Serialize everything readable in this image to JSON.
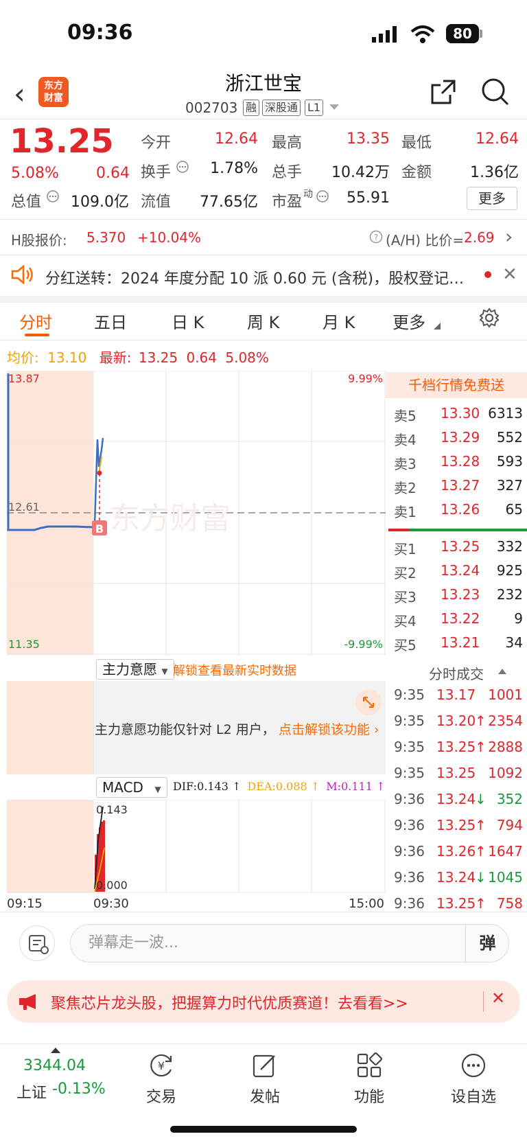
{
  "status": {
    "time": "09:36",
    "battery": "80"
  },
  "header": {
    "logo_line1": "东方",
    "logo_line2": "财富",
    "title": "浙江世宝",
    "code": "002703",
    "tags": [
      "融",
      "深股通",
      "L1"
    ]
  },
  "quote": {
    "price": "13.25",
    "pct": "5.08%",
    "change": "0.64",
    "stats": [
      {
        "label": "今开",
        "value": "12.64",
        "color": "red"
      },
      {
        "label": "最高",
        "value": "13.35",
        "color": "red"
      },
      {
        "label": "最低",
        "value": "12.64",
        "color": "red"
      },
      {
        "label": "换手",
        "value": "1.78%",
        "color": "dark"
      },
      {
        "label": "总手",
        "value": "10.42万",
        "color": "dark"
      },
      {
        "label": "金额",
        "value": "1.36亿",
        "color": "dark"
      },
      {
        "label": "总值",
        "value": "109.0亿",
        "color": "dark"
      },
      {
        "label": "流值",
        "value": "77.65亿",
        "color": "dark"
      },
      {
        "label": "市盈",
        "value": "55.91",
        "color": "dark"
      }
    ],
    "pe_super": "动",
    "more": "更多"
  },
  "hshare": {
    "label": "H股报价:",
    "price": "5.370",
    "pct": "+10.04%",
    "ah_label": "(A/H) 比价=",
    "ah_value": "2.69"
  },
  "dividend": {
    "text": "分红送转：2024 年度分配 10 派 0.60 元 (含税)，股权登记日..."
  },
  "tabs": [
    "分时",
    "五日",
    "日 K",
    "周 K",
    "月 K",
    "更多"
  ],
  "avg": {
    "label": "均价:",
    "value": "13.10",
    "latest_label": "最新:",
    "latest": "13.25",
    "chg": "0.64",
    "pct": "5.08%"
  },
  "chart": {
    "ymax": "13.87",
    "ymid": "12.61",
    "ymin": "11.35",
    "pmax": "9.99%",
    "pmin": "-9.99%",
    "marker": "B",
    "watermark": "东方财富"
  },
  "orderbook": {
    "promo": "千档行情免费送",
    "asks": [
      {
        "label": "卖5",
        "price": "13.30",
        "vol": "6313"
      },
      {
        "label": "卖4",
        "price": "13.29",
        "vol": "552"
      },
      {
        "label": "卖3",
        "price": "13.28",
        "vol": "593"
      },
      {
        "label": "卖2",
        "price": "13.27",
        "vol": "327"
      },
      {
        "label": "卖1",
        "price": "13.26",
        "vol": "65"
      }
    ],
    "bids": [
      {
        "label": "买1",
        "price": "13.25",
        "vol": "332"
      },
      {
        "label": "买2",
        "price": "13.24",
        "vol": "925"
      },
      {
        "label": "买3",
        "price": "13.23",
        "vol": "232"
      },
      {
        "label": "买4",
        "price": "13.22",
        "vol": "9"
      },
      {
        "label": "买5",
        "price": "13.21",
        "vol": "34"
      }
    ]
  },
  "trades": {
    "title": "分时成交",
    "rows": [
      {
        "time": "9:35",
        "price": "13.17",
        "arrow": "",
        "vol": "1001",
        "color": "red"
      },
      {
        "time": "9:35",
        "price": "13.20",
        "arrow": "↑",
        "vol": "2354",
        "color": "red"
      },
      {
        "time": "9:35",
        "price": "13.25",
        "arrow": "↑",
        "vol": "2888",
        "color": "red"
      },
      {
        "time": "9:35",
        "price": "13.25",
        "arrow": "",
        "vol": "1092",
        "color": "red"
      },
      {
        "time": "9:36",
        "price": "13.24",
        "arrow": "↓",
        "vol": "352",
        "color": "green"
      },
      {
        "time": "9:36",
        "price": "13.25",
        "arrow": "↑",
        "vol": "794",
        "color": "red"
      },
      {
        "time": "9:36",
        "price": "13.26",
        "arrow": "↑",
        "vol": "1647",
        "color": "red"
      },
      {
        "time": "9:36",
        "price": "13.24",
        "arrow": "↓",
        "vol": "1045",
        "color": "green"
      },
      {
        "time": "9:36",
        "price": "13.25",
        "arrow": "↑",
        "vol": "758",
        "color": "red"
      }
    ]
  },
  "sub1": {
    "dropdown": "主力意愿",
    "unlock": "解锁查看最新实时数据",
    "notice": "主力意愿功能仅针对 L2 用户，",
    "notice_link": "点击解锁该功能"
  },
  "macd": {
    "dropdown": "MACD",
    "dif": "DIF:0.143",
    "dea": "DEA:0.088",
    "m": "M:0.111",
    "ymax": "0.143",
    "ymin": "0.000"
  },
  "time_axis": {
    "start": "09:15",
    "open": "09:30",
    "end": "15:00"
  },
  "danmaku": {
    "placeholder": "弹幕走一波...",
    "send": "弹"
  },
  "promo": {
    "text": "聚焦芯片龙头股，把握算力时代优质赛道！去看看>>"
  },
  "bottom_nav": {
    "index_value": "3344.04",
    "index_name": "上证",
    "index_pct": "-0.13%",
    "items": [
      "交易",
      "发帖",
      "功能",
      "设自选"
    ]
  }
}
